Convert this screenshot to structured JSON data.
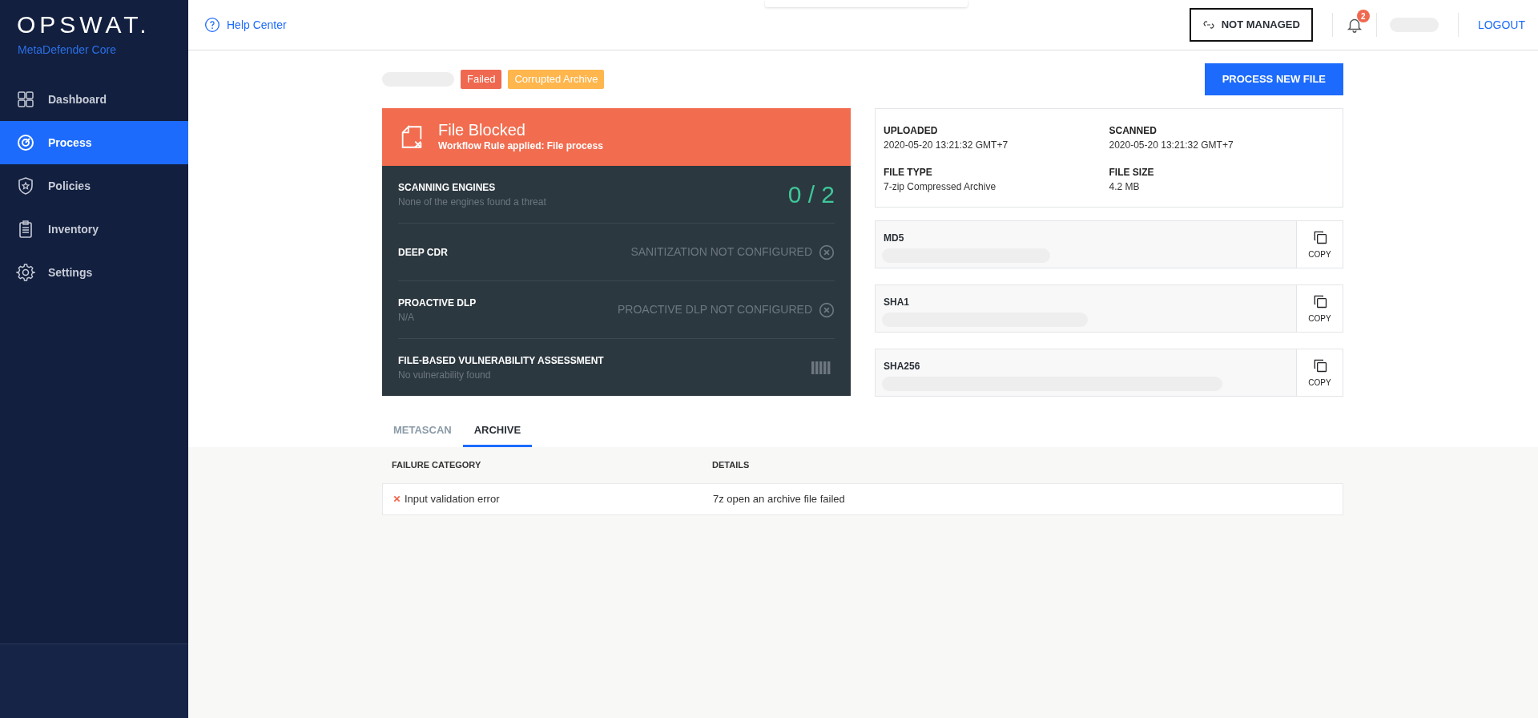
{
  "sidebar": {
    "brand": "OPSWAT.",
    "product": "MetaDefender Core",
    "items": [
      {
        "label": "Dashboard",
        "selected": false
      },
      {
        "label": "Process",
        "selected": true
      },
      {
        "label": "Policies",
        "selected": false
      },
      {
        "label": "Inventory",
        "selected": false
      },
      {
        "label": "Settings",
        "selected": false
      }
    ]
  },
  "header": {
    "help": "Help Center",
    "managed": "NOT MANAGED",
    "notifications": "2",
    "logout": "LOGOUT"
  },
  "file": {
    "tags": [
      {
        "label": "Failed",
        "color": "#ef6950"
      },
      {
        "label": "Corrupted Archive",
        "color": "#ffb64d"
      }
    ],
    "process_button": "PROCESS NEW FILE"
  },
  "verdict": {
    "title": "File Blocked",
    "subtitle": "Workflow Rule applied: File process"
  },
  "engines": [
    {
      "kind": "score",
      "title": "SCANNING ENGINES",
      "subtitle": "None of the engines found a threat",
      "result": "0 / 2"
    },
    {
      "kind": "status",
      "title": "DEEP CDR",
      "result": "SANITIZATION NOT CONFIGURED"
    },
    {
      "kind": "status",
      "title": "PROACTIVE DLP",
      "subtitle": "N/A",
      "result": "PROACTIVE DLP NOT CONFIGURED"
    },
    {
      "kind": "bars",
      "title": "FILE-BASED VULNERABILITY ASSESSMENT",
      "subtitle": "No vulnerability found"
    }
  ],
  "info": [
    {
      "label": "UPLOADED",
      "value": "2020-05-20 13:21:32 GMT+7"
    },
    {
      "label": "SCANNED",
      "value": "2020-05-20 13:21:32 GMT+7"
    },
    {
      "label": "FILE TYPE",
      "value": "7-zip Compressed Archive"
    },
    {
      "label": "FILE SIZE",
      "value": "4.2 MB"
    }
  ],
  "hashes": [
    {
      "label": "MD5",
      "copy": "COPY"
    },
    {
      "label": "SHA1",
      "copy": "COPY"
    },
    {
      "label": "SHA256",
      "copy": "COPY"
    }
  ],
  "tabs": [
    {
      "label": "METASCAN",
      "selected": false
    },
    {
      "label": "ARCHIVE",
      "selected": true
    }
  ],
  "table": {
    "columns": [
      "FAILURE CATEGORY",
      "DETAILS"
    ],
    "rows": [
      {
        "failed": true,
        "cells": [
          "Input validation error",
          "7z open an archive file failed"
        ]
      }
    ]
  }
}
